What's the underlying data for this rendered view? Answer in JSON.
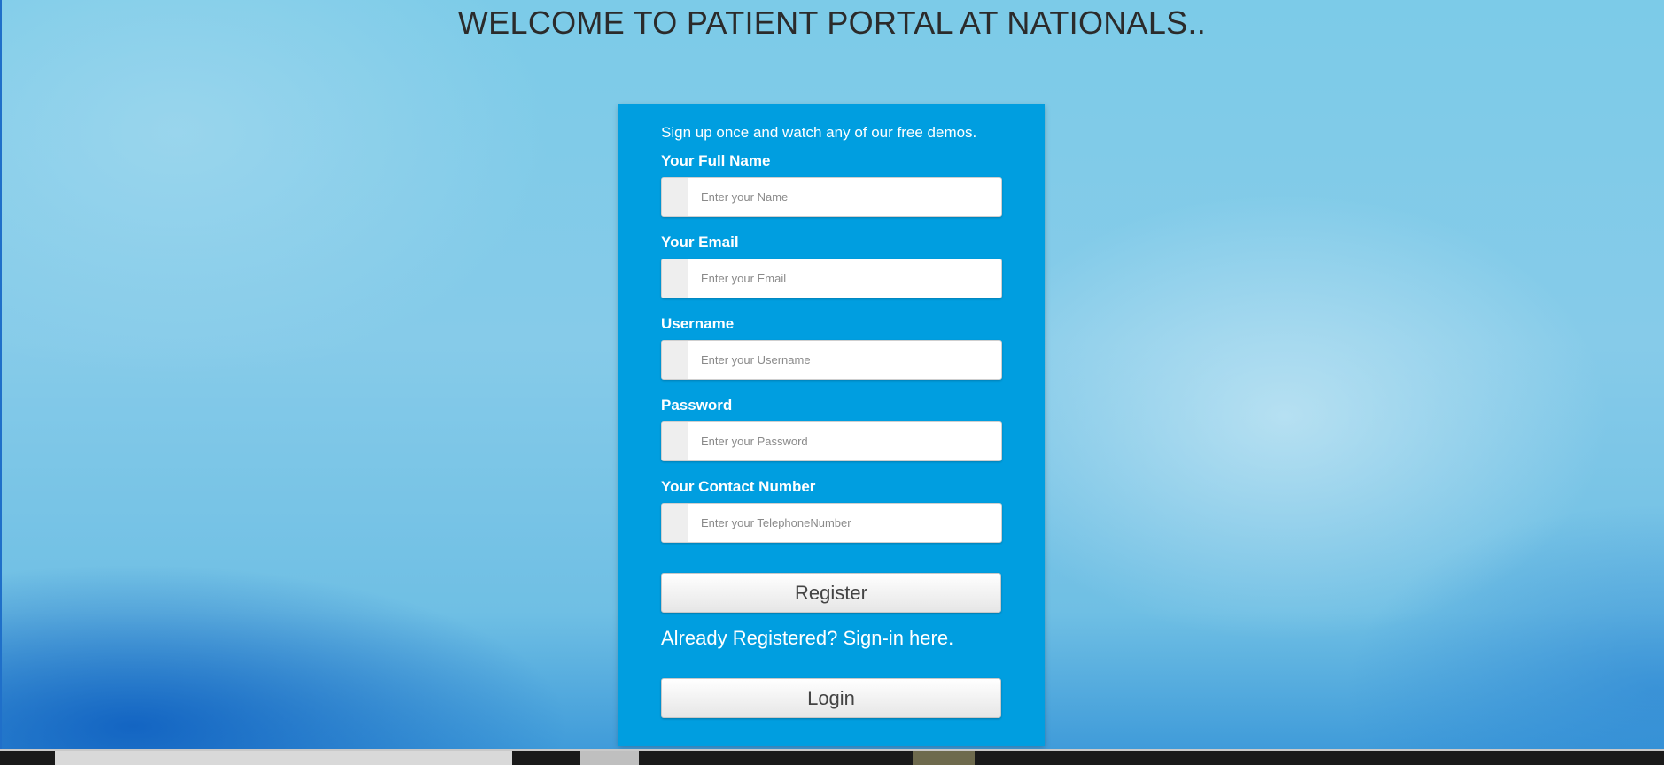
{
  "header": {
    "title": "WELCOME TO PATIENT PORTAL AT NATIONALS.."
  },
  "form": {
    "intro": "Sign up once and watch any of our free demos.",
    "fields": [
      {
        "label": "Your Full Name",
        "placeholder": "Enter your Name",
        "value": ""
      },
      {
        "label": "Your Email",
        "placeholder": "Enter your Email",
        "value": ""
      },
      {
        "label": "Username",
        "placeholder": "Enter your Username",
        "value": ""
      },
      {
        "label": "Password",
        "placeholder": "Enter your Password",
        "value": ""
      },
      {
        "label": "Your Contact Number",
        "placeholder": "Enter your TelephoneNumber",
        "value": ""
      }
    ],
    "register_label": "Register",
    "signin_prompt": "Already Registered? Sign-in here.",
    "login_label": "Login"
  },
  "colors": {
    "card_background": "#009ee0",
    "title_text": "#2b2b2b"
  }
}
